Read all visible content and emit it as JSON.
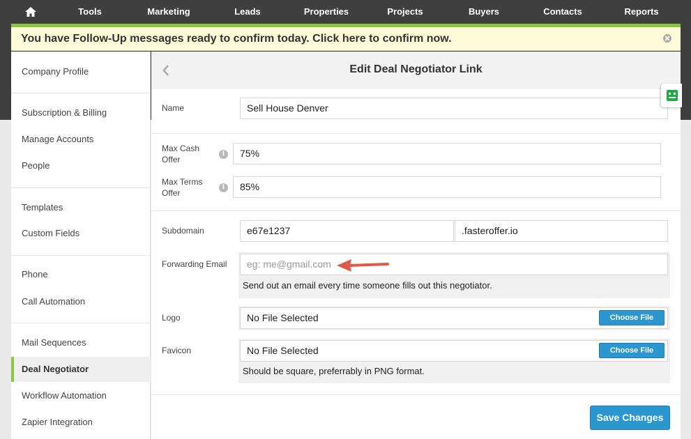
{
  "nav": {
    "home_icon": "home-icon",
    "items": [
      "Tools",
      "Marketing",
      "Leads",
      "Properties",
      "Projects",
      "Buyers",
      "Contacts",
      "Reports"
    ]
  },
  "alert": {
    "text": "You have Follow-Up messages ready to confirm today. Click here to confirm now."
  },
  "sidebar": {
    "items": [
      "Company Profile",
      "Subscription & Billing",
      "Manage Accounts",
      "People",
      "Templates",
      "Custom Fields",
      "Phone",
      "Call Automation",
      "Mail Sequences",
      "Deal Negotiator",
      "Workflow Automation",
      "Zapier Integration"
    ],
    "active": "Deal Negotiator"
  },
  "form": {
    "title": "Edit Deal Negotiator Link",
    "name_label": "Name",
    "name_value": "Sell House Denver",
    "max_cash_label": "Max Cash Offer",
    "max_cash_value": "75%",
    "max_terms_label": "Max Terms Offer",
    "max_terms_value": "85%",
    "subdomain_label": "Subdomain",
    "subdomain_value": "e67e1237",
    "subdomain_suffix": ".fasteroffer.io",
    "forwarding_label": "Forwarding Email",
    "forwarding_placeholder": "eg: me@gmail.com",
    "forwarding_help": "Send out an email every time someone fills out this negotiator.",
    "logo_label": "Logo",
    "logo_value": "No File Selected",
    "favicon_label": "Favicon",
    "favicon_value": "No File Selected",
    "favicon_help": "Should be square, preferrably in PNG format.",
    "choose_file_label": "Choose File",
    "save_label": "Save Changes",
    "info_glyph": "i"
  },
  "colors": {
    "accent_green": "#8cc63f",
    "button_blue": "#2b97d0",
    "arrow_red": "#e0594a",
    "nav_bg": "#3f3f3f",
    "alert_bg": "#fefbd8"
  }
}
